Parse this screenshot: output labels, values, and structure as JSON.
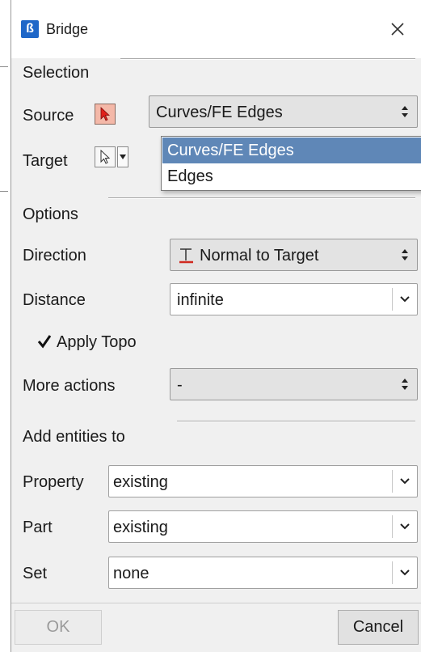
{
  "window": {
    "title": "Bridge",
    "icon": "app-logo-icon",
    "close_icon": "close-icon"
  },
  "selection": {
    "group_title": "Selection",
    "source": {
      "label": "Source",
      "tool_icon": "cursor-arrow-icon",
      "value": "Curves/FE Edges"
    },
    "target": {
      "label": "Target",
      "tool_icon": "cursor-arrow-icon",
      "dropdown_icon": "chevron-down-icon"
    },
    "dropdown_options": [
      "Curves/FE Edges",
      "Edges"
    ],
    "dropdown_selected": "Curves/FE Edges"
  },
  "options": {
    "group_title": "Options",
    "direction": {
      "label": "Direction",
      "value": "Normal to Target",
      "icon": "normal-to-target-icon"
    },
    "distance": {
      "label": "Distance",
      "value": "infinite"
    },
    "apply_topo": {
      "label": "Apply Topo",
      "checked": true
    },
    "more_actions": {
      "label": "More actions",
      "value": "-"
    }
  },
  "add_entities": {
    "group_title": "Add entities to",
    "property": {
      "label": "Property",
      "value": "existing"
    },
    "part": {
      "label": "Part",
      "value": "existing"
    },
    "set": {
      "label": "Set",
      "value": "none"
    }
  },
  "footer": {
    "ok_label": "OK",
    "cancel_label": "Cancel"
  }
}
